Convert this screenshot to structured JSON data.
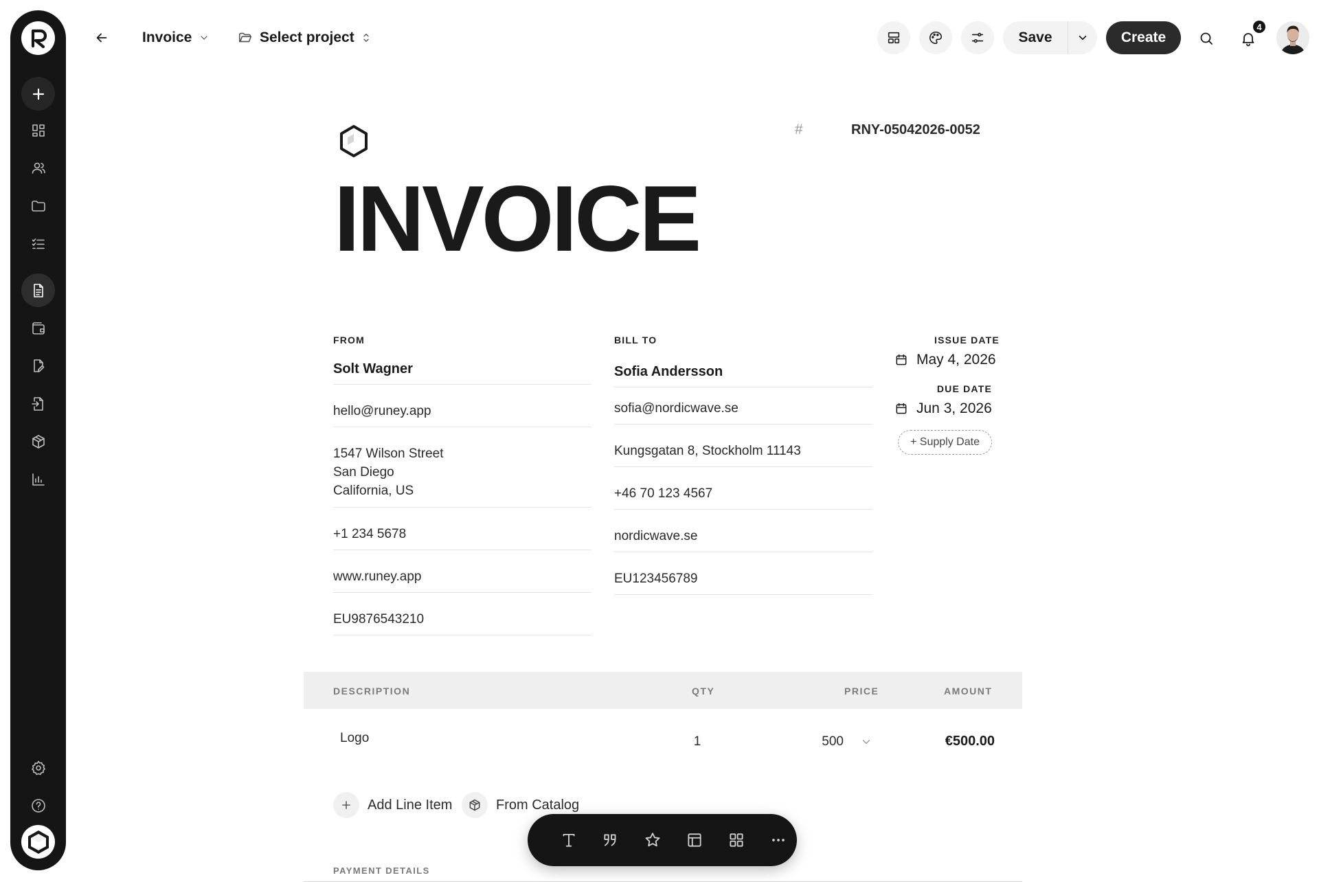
{
  "topbar": {
    "doc_type": "Invoice",
    "project": "Select project",
    "save_label": "Save",
    "create_label": "Create",
    "notification_count": "4"
  },
  "invoice": {
    "number_hash": "#",
    "number": "RNY-05042026-0052",
    "title": "INVOICE",
    "from": {
      "label": "FROM",
      "name": "Solt Wagner",
      "email": "hello@runey.app",
      "address_line1": "1547 Wilson Street",
      "address_line2": "San Diego",
      "address_line3": "California, US",
      "phone": "+1 234 5678",
      "website": "www.runey.app",
      "vat": "EU9876543210"
    },
    "bill_to": {
      "label": "BILL TO",
      "name": "Sofia Andersson",
      "email": "sofia@nordicwave.se",
      "address": "Kungsgatan 8, Stockholm 11143",
      "phone": "+46 70 123 4567",
      "website": "nordicwave.se",
      "vat": "EU123456789"
    },
    "issue_date_label": "ISSUE DATE",
    "issue_date": "May 4, 2026",
    "due_date_label": "DUE DATE",
    "due_date": "Jun 3, 2026",
    "supply_date_label": "+ Supply Date"
  },
  "table": {
    "headers": {
      "description": "DESCRIPTION",
      "qty": "QTY",
      "price": "PRICE",
      "amount": "AMOUNT"
    },
    "rows": [
      {
        "description": "Logo",
        "qty": "1",
        "price": "500",
        "amount": "€500.00"
      }
    ],
    "add_line_item": "Add Line Item",
    "from_catalog": "From Catalog"
  },
  "payment_details_label": "PAYMENT DETAILS",
  "icons": {
    "sidebar": [
      "app-logo",
      "plus-icon",
      "dashboard-icon",
      "users-icon",
      "folder-icon",
      "tasks-icon",
      "document-icon",
      "wallet-icon",
      "edit-document-icon",
      "import-icon",
      "package-icon",
      "chart-icon",
      "gear-icon",
      "help-icon"
    ],
    "floating_toolbar": [
      "text-icon",
      "quote-icon",
      "star-icon",
      "table-icon",
      "grid-icon",
      "more-icon"
    ]
  }
}
